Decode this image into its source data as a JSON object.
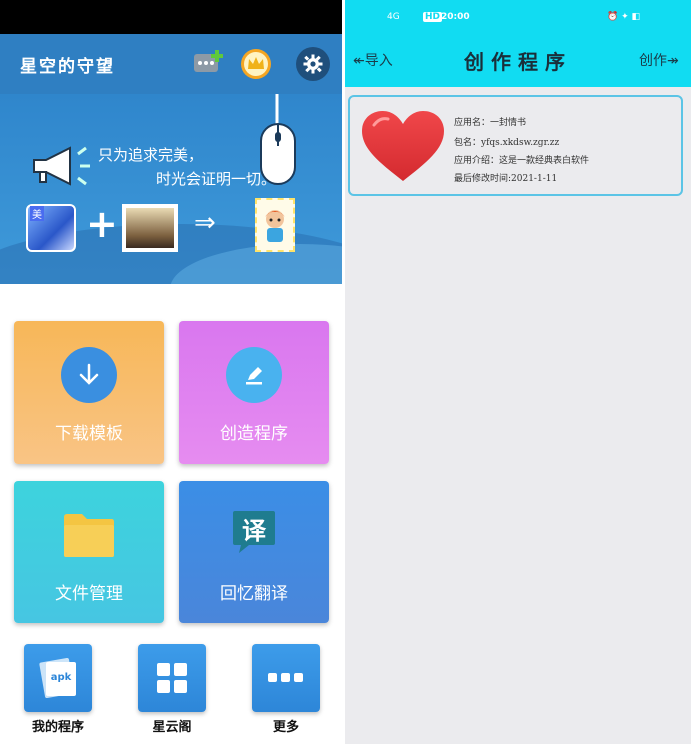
{
  "left": {
    "app_title": "星空的守望",
    "banner": {
      "slogan_line1": "只为追求完美，",
      "slogan_line2": "时光会证明一切。",
      "tile_a_badge": "美",
      "plus": "+",
      "arrow": "⇒"
    },
    "cards": {
      "download_label": "下载模板",
      "create_label": "创造程序",
      "files_label": "文件管理",
      "translate_label": "回忆翻译",
      "translate_glyph": "译"
    },
    "bottom": {
      "my_programs_label": "我的程序",
      "my_programs_badge": "apk",
      "star_cloud_label": "星云阁",
      "more_label": "更多"
    },
    "colors": {
      "appbar": "#2f7fc2",
      "download_card": "#f7b758",
      "create_card": "#d977ef",
      "files_card": "#3dd3dd",
      "translate_card": "#3b8ee6"
    }
  },
  "right": {
    "status": {
      "signal": "4G",
      "hd": "HD",
      "time": "20:00",
      "right_indicators": "⏰ ✦ ◧"
    },
    "header": {
      "import_label": "↞导入",
      "title": "创作程序",
      "create_label": "创作↠"
    },
    "app_item": {
      "name_line": "应用名：一封情书",
      "package_line": "包名：yfqs.xkdsw.zgr.zz",
      "intro_line": "应用介绍：这是一款经典表白软件",
      "modified_line": "最后修改时间:2021-1-11"
    },
    "colors": {
      "header": "#11dcf2",
      "card_border": "#5bc4e6",
      "heart": "#e23a3a"
    }
  }
}
